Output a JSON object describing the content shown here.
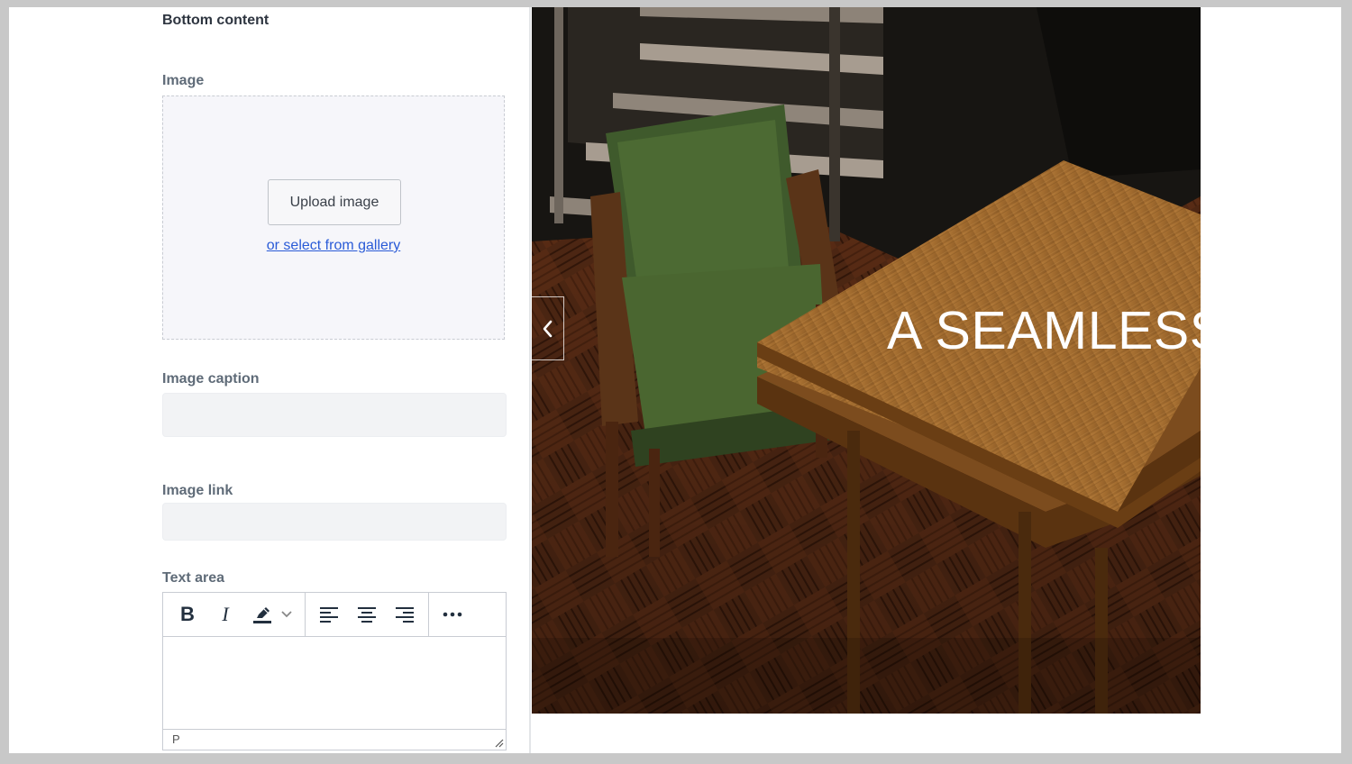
{
  "editor_panel": {
    "section_title": "Bottom content",
    "image": {
      "label": "Image",
      "upload_button": "Upload image",
      "gallery_link": "or select from gallery"
    },
    "image_caption": {
      "label": "Image caption",
      "value": ""
    },
    "image_link": {
      "label": "Image link",
      "value": ""
    },
    "text_area": {
      "label": "Text area",
      "toolbar": {
        "bold_label": "B",
        "italic_label": "I",
        "icons": [
          "highlight-color-icon",
          "chevron-down-icon",
          "align-left-icon",
          "align-center-icon",
          "align-right-icon",
          "more-options-icon"
        ]
      },
      "content": "",
      "status_path": "P"
    }
  },
  "preview": {
    "hero_text": "A SEAMLESS",
    "icons": [
      "chevron-left-icon"
    ]
  },
  "colors": {
    "link": "#2a5bd7",
    "panel_background": "#ffffff",
    "dropzone_background": "#f6f6fa",
    "input_background": "#f2f3f5"
  }
}
